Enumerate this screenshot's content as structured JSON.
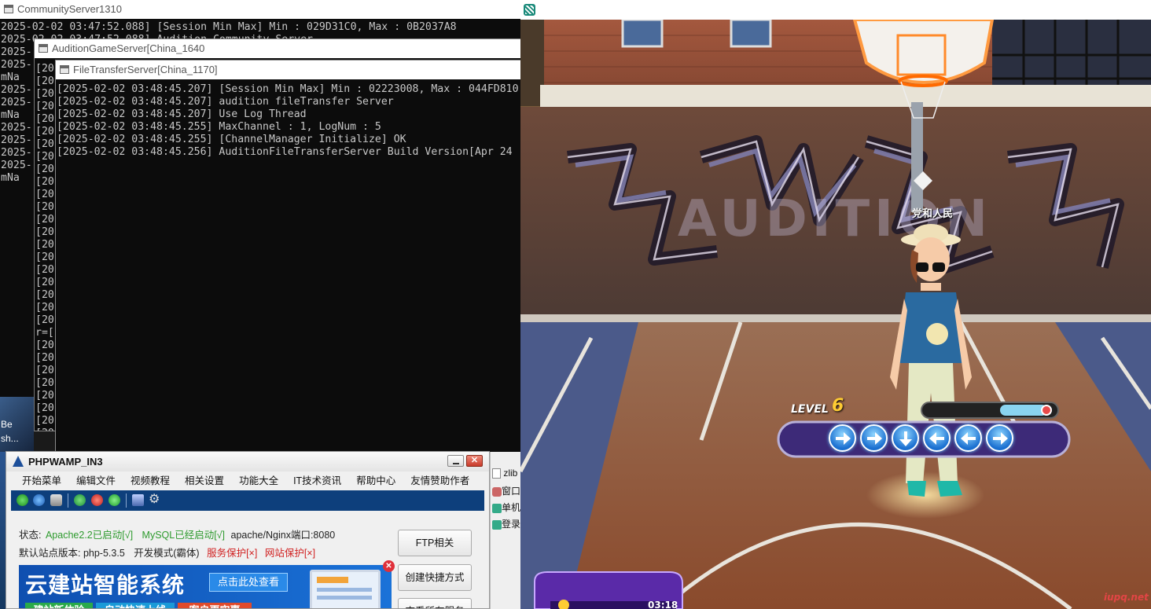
{
  "console1": {
    "title": "CommunityServer1310",
    "lines": [
      "2025-02-02 03:47:52.088] [Session Min Max] Min : 029D31C0, Max : 0B2037A8",
      "2025-02-02 03:47:52.088] Audition Community Server",
      "2025-(",
      "2025-(",
      "mNa",
      "2025-(",
      "2025-(",
      "mNa",
      "2025-(",
      "2025-(",
      "2025-(",
      "2025-(",
      "mNa"
    ]
  },
  "console2": {
    "title": "AuditionGameServer[China_1640",
    "lines": [
      "[20",
      "[20",
      "[20",
      "[20",
      "[20",
      "[20",
      "[20",
      "[20",
      "[20",
      "[20",
      "[20",
      "[20",
      "[20",
      "[20",
      "[20",
      "[20",
      "[20",
      "[20",
      "[20",
      "[20",
      "[20",
      "r=[",
      "[20",
      "[20",
      "[20",
      "[20",
      "[20",
      "[20",
      "[20",
      "[20"
    ]
  },
  "console3": {
    "title": "FileTransferServer[China_1170]",
    "lines": [
      "[2025-02-02 03:48:45.207] [Session Min Max] Min : 02223008, Max : 044FD810",
      "[2025-02-02 03:48:45.207] audition fileTransfer Server",
      "[2025-02-02 03:48:45.207] Use Log Thread",
      "[2025-02-02 03:48:45.255] MaxChannel : 1, LogNum : 5",
      "[2025-02-02 03:48:45.255] [ChannelManager Initialize] OK",
      "[2025-02-02 03:48:45.256] AuditionFileTransferServer Build Version[Apr 24"
    ]
  },
  "desktop": {
    "side_left": [
      "Be",
      "sh..."
    ],
    "side_right": [
      "zlib",
      "窗口",
      "单机",
      "登录"
    ]
  },
  "game": {
    "player_name": "党和人民",
    "level_label": "LEVEL",
    "level_value": "6",
    "arrows": [
      "right",
      "right",
      "down",
      "left",
      "left",
      "right"
    ],
    "timer": "03:18",
    "watermark": "iupq.net",
    "graffiti_text": "AUDITION",
    "colors": {
      "arrow_blue": "#2a8ee8",
      "track_purple": "#4a2f86"
    }
  },
  "phpwamp": {
    "title": "PHPWAMP_IN3",
    "menu": [
      "开始菜单",
      "编辑文件",
      "视频教程",
      "相关设置",
      "功能大全",
      "IT技术资讯",
      "帮助中心",
      "友情赞助作者"
    ],
    "status_label": "状态:",
    "apache_status": "Apache2.2已启动[√]",
    "mysql_status": "MySQL已经启动[√]",
    "port": "apache/Nginx端口:8080",
    "default_version": "默认站点版本: php-5.3.5",
    "dev_mode": "开发模式(霸体)",
    "service_protect": "服务保护[×]",
    "site_protect": "网站保护[×]",
    "buttons": [
      "FTP相关",
      "创建快捷方式",
      "查看所有服务"
    ],
    "banner_title": "云建站智能系统",
    "banner_cta": "点击此处查看",
    "banner_tags": [
      "建站新体验",
      "自动快速上线",
      "客户更实惠"
    ],
    "colors": {
      "ok_green": "#2d9a2d",
      "warn_red": "#d02020",
      "banner_blue": "#1565c0"
    }
  }
}
